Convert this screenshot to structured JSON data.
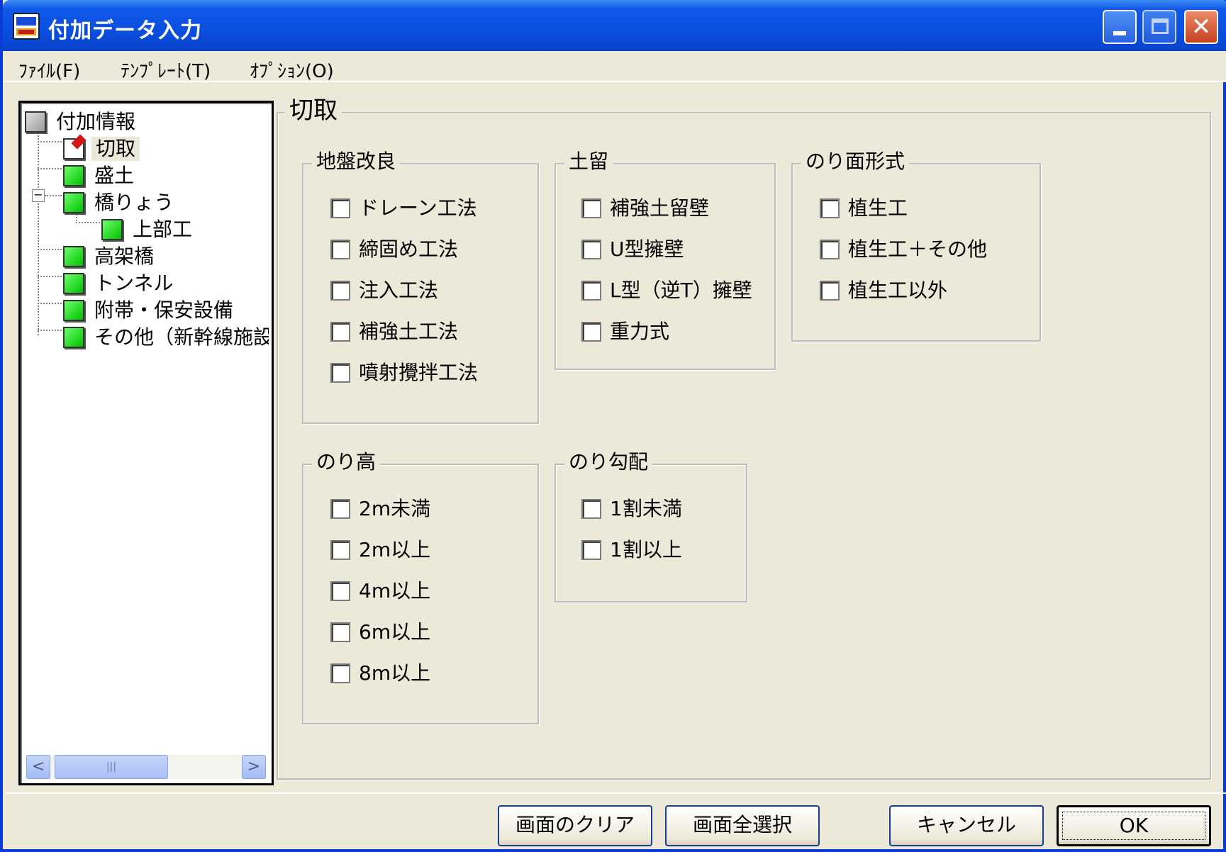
{
  "window": {
    "title": "付加データ入力",
    "close_glyph": "✕"
  },
  "menubar": {
    "items": [
      "ﾌｧｲﾙ(F)",
      "ﾃﾝﾌﾟﾚｰﾄ(T)",
      "ｵﾌﾟｼｮﾝ(O)"
    ]
  },
  "tree": {
    "root": "付加情報",
    "nodes": [
      "切取",
      "盛土",
      "橋りょう",
      "上部工",
      "高架橋",
      "トンネル",
      "附帯・保安設備",
      "その他（新幹線施設"
    ],
    "expander": "−",
    "scroll": {
      "left": "<",
      "right": ">",
      "thumb": "|||"
    }
  },
  "main": {
    "legend": "切取",
    "groups": {
      "jiban": {
        "title": "地盤改良",
        "items": [
          "ドレーン工法",
          "締固め工法",
          "注入工法",
          "補強土工法",
          "噴射攪拌工法"
        ]
      },
      "dodome": {
        "title": "土留",
        "items": [
          "補強土留壁",
          "U型擁壁",
          "L型（逆T）擁壁",
          "重力式"
        ]
      },
      "norimen": {
        "title": "のり面形式",
        "items": [
          "植生工",
          "植生工＋その他",
          "植生工以外"
        ]
      },
      "noridaka": {
        "title": "のり高",
        "items": [
          "2m未満",
          "2m以上",
          "4m以上",
          "6m以上",
          "8m以上"
        ]
      },
      "norikoubai": {
        "title": "のり勾配",
        "items": [
          "1割未満",
          "1割以上"
        ]
      }
    }
  },
  "buttons": {
    "clear": "画面のクリア",
    "select_all": "画面全選択",
    "cancel": "キャンセル",
    "ok": "OK"
  }
}
